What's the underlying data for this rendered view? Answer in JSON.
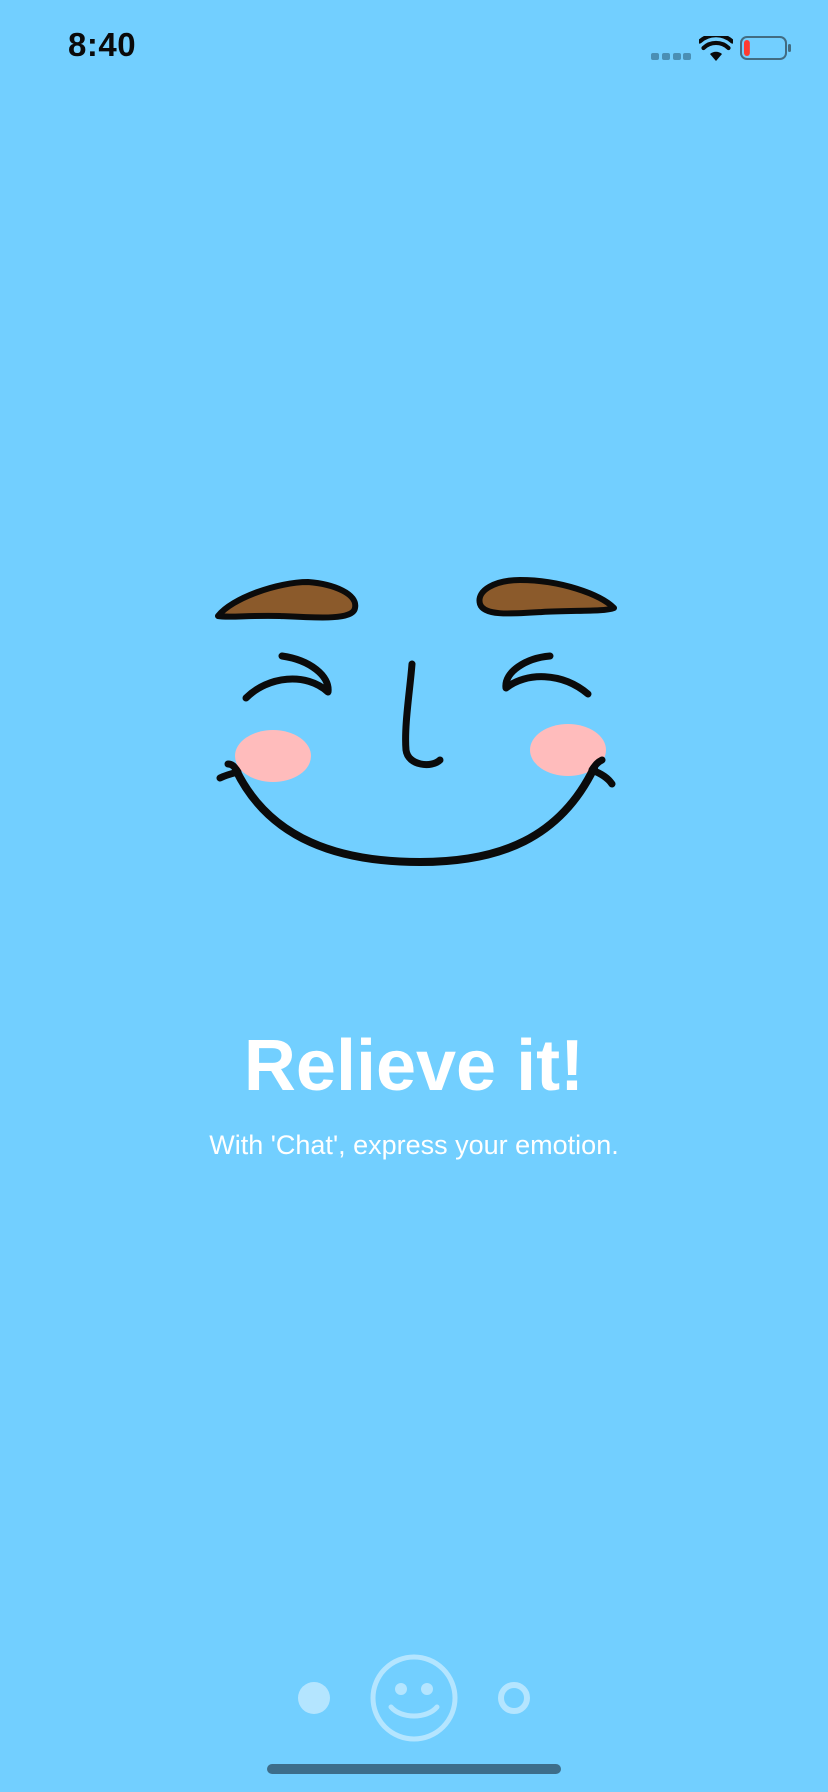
{
  "status_bar": {
    "time": "8:40",
    "signal_icon": "cellular-signal-icon",
    "wifi_icon": "wifi-icon",
    "battery_icon": "battery-low-icon",
    "battery_level": 0.15
  },
  "onboarding": {
    "illustration_icon": "smiling-face-icon",
    "headline": "Relieve it!",
    "subtitle": "With 'Chat', express your emotion."
  },
  "page_indicator": {
    "pages": [
      {
        "icon": "dot-filled-icon",
        "active": false
      },
      {
        "icon": "smiley-face-icon",
        "active": true
      },
      {
        "icon": "dot-ring-icon",
        "active": false
      }
    ],
    "current_page": 2,
    "page_count": 3
  },
  "colors": {
    "background": "#72cfff",
    "text_primary": "#ffffff",
    "status_text": "#0a0a0a",
    "eyebrow": "#8b5a2b",
    "blush": "#ffbcbc",
    "outline": "#0b0b0b",
    "indicator": "#b4e5ff",
    "battery_low": "#ff3b30",
    "signal_dim": "#4a8fb4",
    "home_indicator": "#3d6d8a"
  }
}
